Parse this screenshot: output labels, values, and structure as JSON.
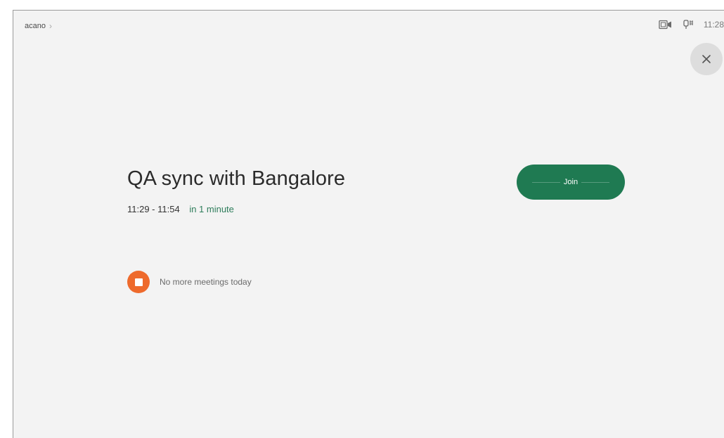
{
  "header": {
    "brand": "acano",
    "brand_chevron": "›",
    "camera_icon": "camera-status-icon",
    "mic_icon": "microphone-status-icon",
    "clock": "11:28"
  },
  "close_button": {
    "symbol": "✕",
    "icon": "close-icon"
  },
  "meeting": {
    "title": "QA sync with Bangalore",
    "time_range": "11:29 - 11:54",
    "relative_time": "in 1 minute",
    "join_label": "Join"
  },
  "notice": {
    "icon": "stop-icon",
    "text": "No more meetings today"
  },
  "colors": {
    "accent_green": "#1f7a52",
    "relative_time_green": "#2e7d5b",
    "notice_orange": "#ee6a2c",
    "background": "#f3f3f3"
  }
}
